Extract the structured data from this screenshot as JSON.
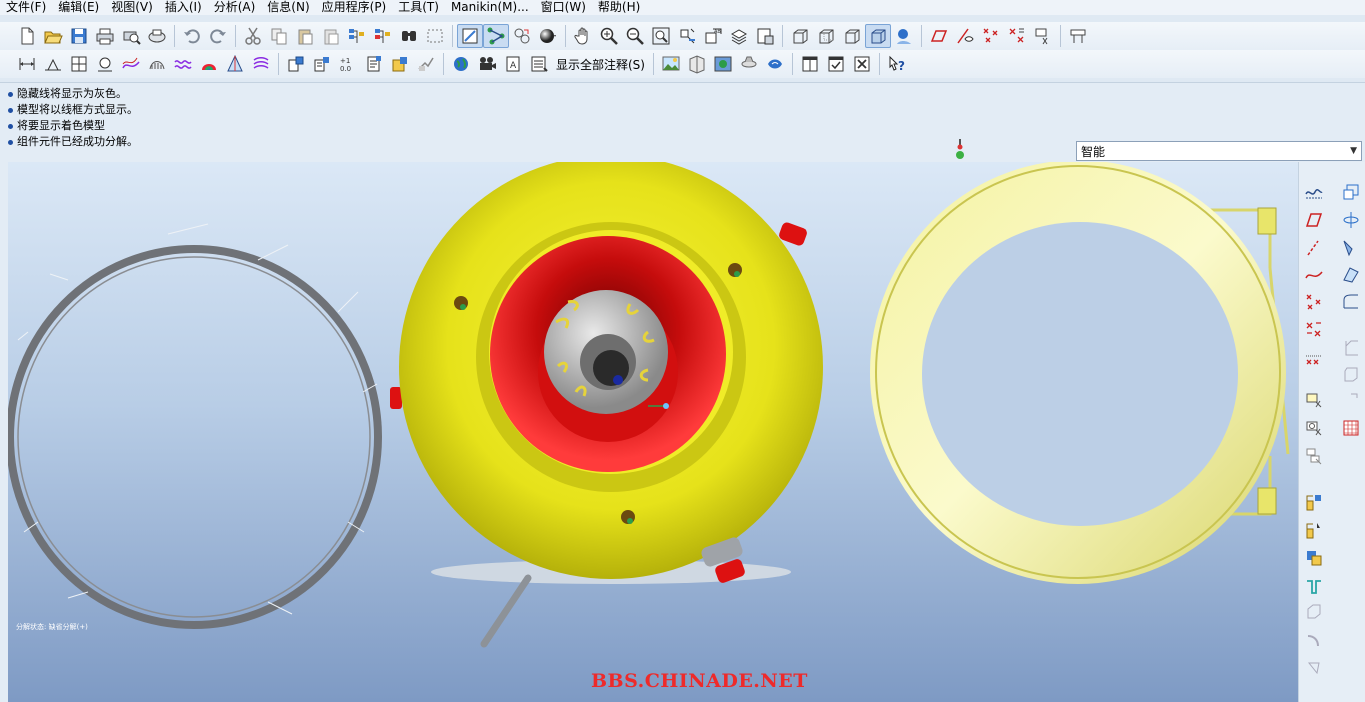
{
  "menu": [
    "文件(F)",
    "编辑(E)",
    "视图(V)",
    "插入(I)",
    "分析(A)",
    "信息(N)",
    "应用程序(P)",
    "工具(T)",
    "Manikin(M)...",
    "窗口(W)",
    "帮助(H)"
  ],
  "toolbar2": {
    "show_annotations_label": "显示全部注释(S)"
  },
  "messages": [
    "隐藏线将显示为灰色。",
    "模型将以线框方式显示。",
    "将要显示着色模型",
    "组件元件已经成功分解。"
  ],
  "filter": {
    "selected": "智能"
  },
  "viewport": {
    "state_text": "分解状态: 缺省分解(+)",
    "watermark": "BBS.CHINADE.NET"
  },
  "colors": {
    "accent_blue": "#1f4fa3",
    "part_yellow": "#e9e61a",
    "part_red": "#e01818",
    "ring_pale": "#f2f090",
    "wireframe_gray": "#6f7277",
    "watermark_red": "#ee2a2a"
  },
  "icons": {
    "toolbar1": [
      "new-icon",
      "open-icon",
      "save-icon",
      "print-icon",
      "print-preview-icon",
      "quick-print-icon",
      "undo-icon",
      "redo-icon",
      "cut-icon",
      "copy-icon",
      "paste-icon",
      "paste-special-icon",
      "regenerate-icon",
      "regen-manager-icon",
      "find-icon",
      "select-box-icon",
      "refit-icon",
      "spin-center-icon",
      "orient-icon",
      "shade-icon",
      "pan-icon",
      "zoom-in-icon",
      "zoom-out-icon",
      "zoom-fit-icon",
      "repaint-icon",
      "named-view-icon",
      "layers-icon",
      "model-tree-icon",
      "wireframe-icon",
      "hidden-line-icon",
      "no-hidden-icon",
      "shaded-icon",
      "enhanced-realism-icon",
      "datum-plane-display-icon",
      "datum-axis-display-icon",
      "point-display-icon",
      "csys-display-icon",
      "annotation-display-icon",
      "spin-center-display-icon"
    ],
    "toolbar2": [
      "dimension-icon",
      "surface-finish-icon",
      "datum-table-icon",
      "geometric-tolerance-icon",
      "cable-icon",
      "harness-icon",
      "wave-icon",
      "color-icon",
      "appearance-icon",
      "layer-icon",
      "note-icon",
      "balloon-icon",
      "bom-icon",
      "symbol-icon",
      "table-icon",
      "format-icon",
      "globe-icon",
      "camera-icon",
      "annotation-icon",
      "note-list-icon",
      "image-icon",
      "scene-icon",
      "environment-icon",
      "render-icon",
      "light-icon",
      "window-icon",
      "activate-window-icon",
      "close-window-icon",
      "help-whats-this-icon"
    ],
    "right": [
      "sketch-curve-icon",
      "datum-plane-icon",
      "datum-axis-icon",
      "curve-icon",
      "datum-point-icon",
      "sketched-point-icon",
      "offset-point-icon",
      "csys-icon",
      "analysis-feature-icon",
      "pattern-icon",
      "assembly-icon",
      "component-icon",
      "pull-icon",
      "insert-icon",
      "shaft-icon",
      "round-icon",
      "chamfer-icon",
      "extrude-icon",
      "revolve-icon",
      "sweep-icon",
      "blend-icon",
      "hole-icon",
      "shell-icon",
      "rib-icon",
      "draft-icon",
      "table-grid-icon"
    ]
  }
}
